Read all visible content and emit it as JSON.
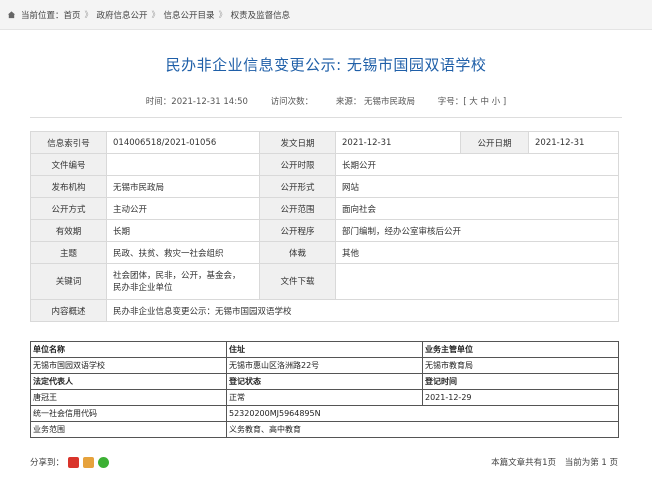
{
  "breadcrumb": {
    "prefix": "当前位置：",
    "items": [
      "首页",
      "政府信息公开",
      "信息公开目录",
      "权责及监督信息"
    ],
    "separator": "》"
  },
  "article": {
    "title": "民办非企业信息变更公示: 无锡市国园双语学校",
    "time": "时间：2021-12-31 14:50",
    "views": "访问次数：",
    "source": "来源： 无锡市民政局",
    "font_size": "字号：[ 大 中 小 ]"
  },
  "info_table": {
    "index_label": "信息索引号",
    "index_value": "014006518/2021-01056",
    "issue_date_label": "发文日期",
    "issue_date_value": "2021-12-31",
    "publish_date_label": "公开日期",
    "publish_date_value": "2021-12-31",
    "doc_no_label": "文件编号",
    "doc_no_value": "",
    "period_label": "公开时限",
    "period_value": "长期公开",
    "issuer_label": "发布机构",
    "issuer_value": "无锡市民政局",
    "form_label": "公开形式",
    "form_value": "网站",
    "method_label": "公开方式",
    "method_value": "主动公开",
    "scope_label": "公开范围",
    "scope_value": "面向社会",
    "validity_label": "有效期",
    "validity_value": "长期",
    "procedure_label": "公开程序",
    "procedure_value": "部门编制，经办公室审核后公开",
    "theme_label": "主题",
    "theme_value": "民政、扶贫、救灾一社会组织",
    "genre_label": "体裁",
    "genre_value": "其他",
    "keywords_label": "关键词",
    "keywords_line1": "社会团体，民非，公开，基金会，",
    "keywords_line2": "民办非企业单位",
    "download_label": "文件下载",
    "summary_label": "内容概述",
    "summary_value": "民办非企业信息变更公示：无锡市国园双语学校"
  },
  "registration": {
    "name_header": "单位名称",
    "address_header": "住址",
    "authority_header": "业务主管单位",
    "name": "无锡市国园双语学校",
    "address": "无锡市惠山区洛洲路22号",
    "authority": "无锡市教育局",
    "rep_header": "法定代表人",
    "status_header": "登记状态",
    "reg_time_header": "登记时间",
    "rep": "唐冠王",
    "status": "正常",
    "reg_time": "2021-12-29",
    "credit_code_label": "统一社会信用代码",
    "credit_code": "52320200MJ5964895N",
    "scope_label": "业务范围",
    "scope": "义务教育、高中教育"
  },
  "footer": {
    "share_label": "分享到：",
    "total_pages": "本篇文章共有1页",
    "current_page": "当前为第 1 页"
  },
  "colors": {
    "title": "#1f5fa8",
    "label_bg": "#f0f0f0",
    "breadcrumb_bg": "#f4f4f4"
  }
}
